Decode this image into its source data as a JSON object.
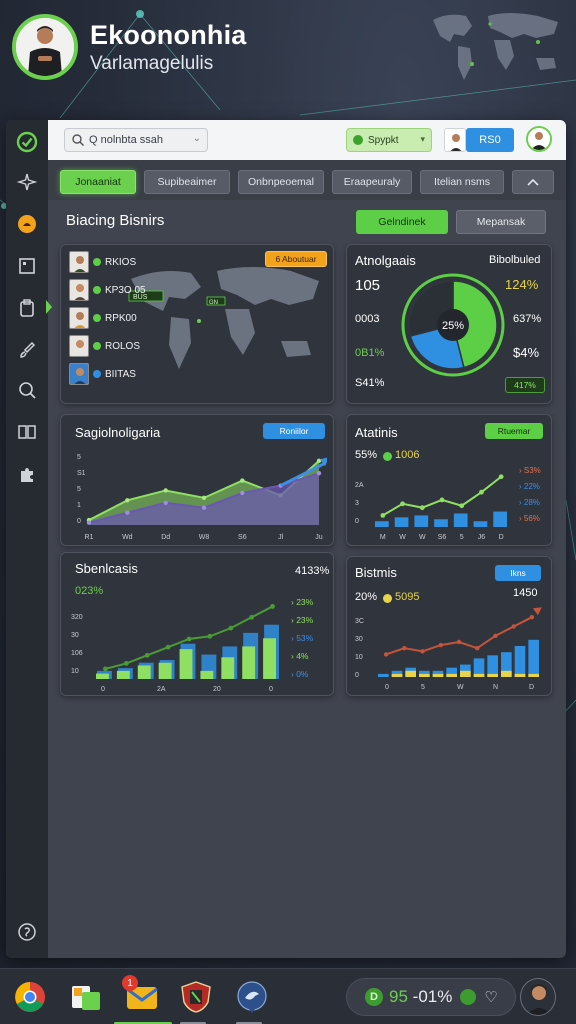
{
  "header": {
    "title": "Ekoononhia",
    "subtitle": "Varlamagelulis"
  },
  "topbar": {
    "search_text": "Q nolnbta ssah",
    "select_value": "Spypkt",
    "button_label": "RS0"
  },
  "tabs": [
    {
      "label": "Jonaaniat",
      "active": true
    },
    {
      "label": "Supibeaimer",
      "active": false
    },
    {
      "label": "Onbnpeoemal",
      "active": false
    },
    {
      "label": "Eraapeuraly",
      "active": false
    },
    {
      "label": "Itelian nsms",
      "active": false
    }
  ],
  "section": {
    "title": "Biacing Bisnirs",
    "button_primary": "Gelndinek",
    "button_secondary": "Mepansak"
  },
  "people_card": {
    "badge": "6 Aboutuar",
    "people": [
      {
        "name": "RKIOS"
      },
      {
        "name": "KP3O 05"
      },
      {
        "name": "RPK00"
      },
      {
        "name": "ROLOS"
      },
      {
        "name": "BIITAS"
      }
    ],
    "map_label_1": "BUS",
    "map_label_2": "GN"
  },
  "donut_card": {
    "title": "Atnolgaais",
    "right_label": "Bibolbuled",
    "left_values": [
      "105",
      "0003",
      "0B1%",
      "S41%"
    ],
    "right_values": [
      "124%",
      "637%",
      "$4%",
      "417%"
    ],
    "center_label": "25%",
    "chart_data": {
      "type": "pie",
      "values": [
        46,
        25,
        29
      ],
      "colors": [
        "#5ccf46",
        "#2f8fe0",
        "#2b2f36"
      ]
    }
  },
  "area_card": {
    "title": "Sagiolnoligaria",
    "badge": "Roniilor",
    "chart_data": {
      "type": "area",
      "categories": [
        "R1",
        "Wd",
        "Dd",
        "W8",
        "S6",
        "Jl",
        "Ju"
      ],
      "y_ticks": [
        "5",
        "S1",
        "5",
        "1",
        "0"
      ],
      "series": [
        {
          "values": [
            2,
            10,
            14,
            11,
            18,
            12,
            26
          ],
          "color": "#8fe062"
        },
        {
          "values": [
            1,
            5,
            9,
            7,
            13,
            16,
            21
          ],
          "color": "#6a58b0"
        }
      ],
      "ylim": [
        0,
        30
      ]
    }
  },
  "bars_card_right_top": {
    "title": "Atatinis",
    "stat_left": "55%",
    "stat_right": "1006",
    "side_values": [
      "S3%",
      "22%",
      "28%",
      "56%"
    ],
    "chart_data": {
      "type": "bar",
      "categories": [
        "M",
        "W",
        "W",
        "S6",
        "5",
        "J6",
        "D"
      ],
      "y_ticks": [
        "2A",
        "3",
        "0"
      ],
      "values": [
        3,
        5,
        6,
        4,
        7,
        3,
        8
      ],
      "line": [
        6,
        12,
        10,
        14,
        11,
        18,
        26
      ],
      "ylim": [
        0,
        30
      ]
    }
  },
  "bars_card_left": {
    "title": "Sbenlcasis",
    "stat": "023%",
    "top_right": "4133%",
    "side_values": [
      "23%",
      "23%",
      "53%",
      "4%",
      "0%"
    ],
    "chart_data": {
      "type": "bar",
      "categories": [
        "0",
        "2A",
        "20",
        "0"
      ],
      "y_ticks": [
        "320",
        "30",
        "106",
        "10"
      ],
      "series": [
        {
          "name": "",
          "values": [
            2,
            3,
            5,
            6,
            11,
            3,
            8,
            12,
            15
          ],
          "color": "#8fe062"
        },
        {
          "name": "",
          "values": [
            3,
            4,
            6,
            7,
            13,
            9,
            12,
            17,
            20
          ],
          "color": "#2f8fe0"
        }
      ],
      "line": [
        3,
        5,
        8,
        11,
        14,
        15,
        18,
        22,
        26
      ],
      "ylim": [
        0,
        28
      ]
    }
  },
  "bars_card_right_bottom": {
    "title": "Bistmis",
    "badge": "Ikns",
    "stat_left": "20%",
    "stat_right": "5095",
    "top_right": "1450",
    "chart_data": {
      "type": "bar",
      "categories": [
        "0",
        "5",
        "W",
        "N",
        "D"
      ],
      "y_ticks": [
        "3C",
        "30",
        "10",
        "0"
      ],
      "series": [
        {
          "values": [
            1,
            2,
            3,
            2,
            2,
            3,
            4,
            6,
            7,
            8,
            10,
            12
          ],
          "color": "#2f8fe0"
        },
        {
          "values": [
            0,
            1,
            2,
            1,
            1,
            1,
            2,
            1,
            1,
            2,
            1,
            1
          ],
          "color": "#e8d44a"
        }
      ],
      "line": [
        6,
        8,
        7,
        9,
        10,
        8,
        12,
        15,
        18
      ],
      "ylim": [
        0,
        20
      ]
    }
  },
  "tray": {
    "status_letter": "D",
    "value_a": "95",
    "value_b": "-01%"
  },
  "taskbar": {
    "notification_count": "1"
  }
}
